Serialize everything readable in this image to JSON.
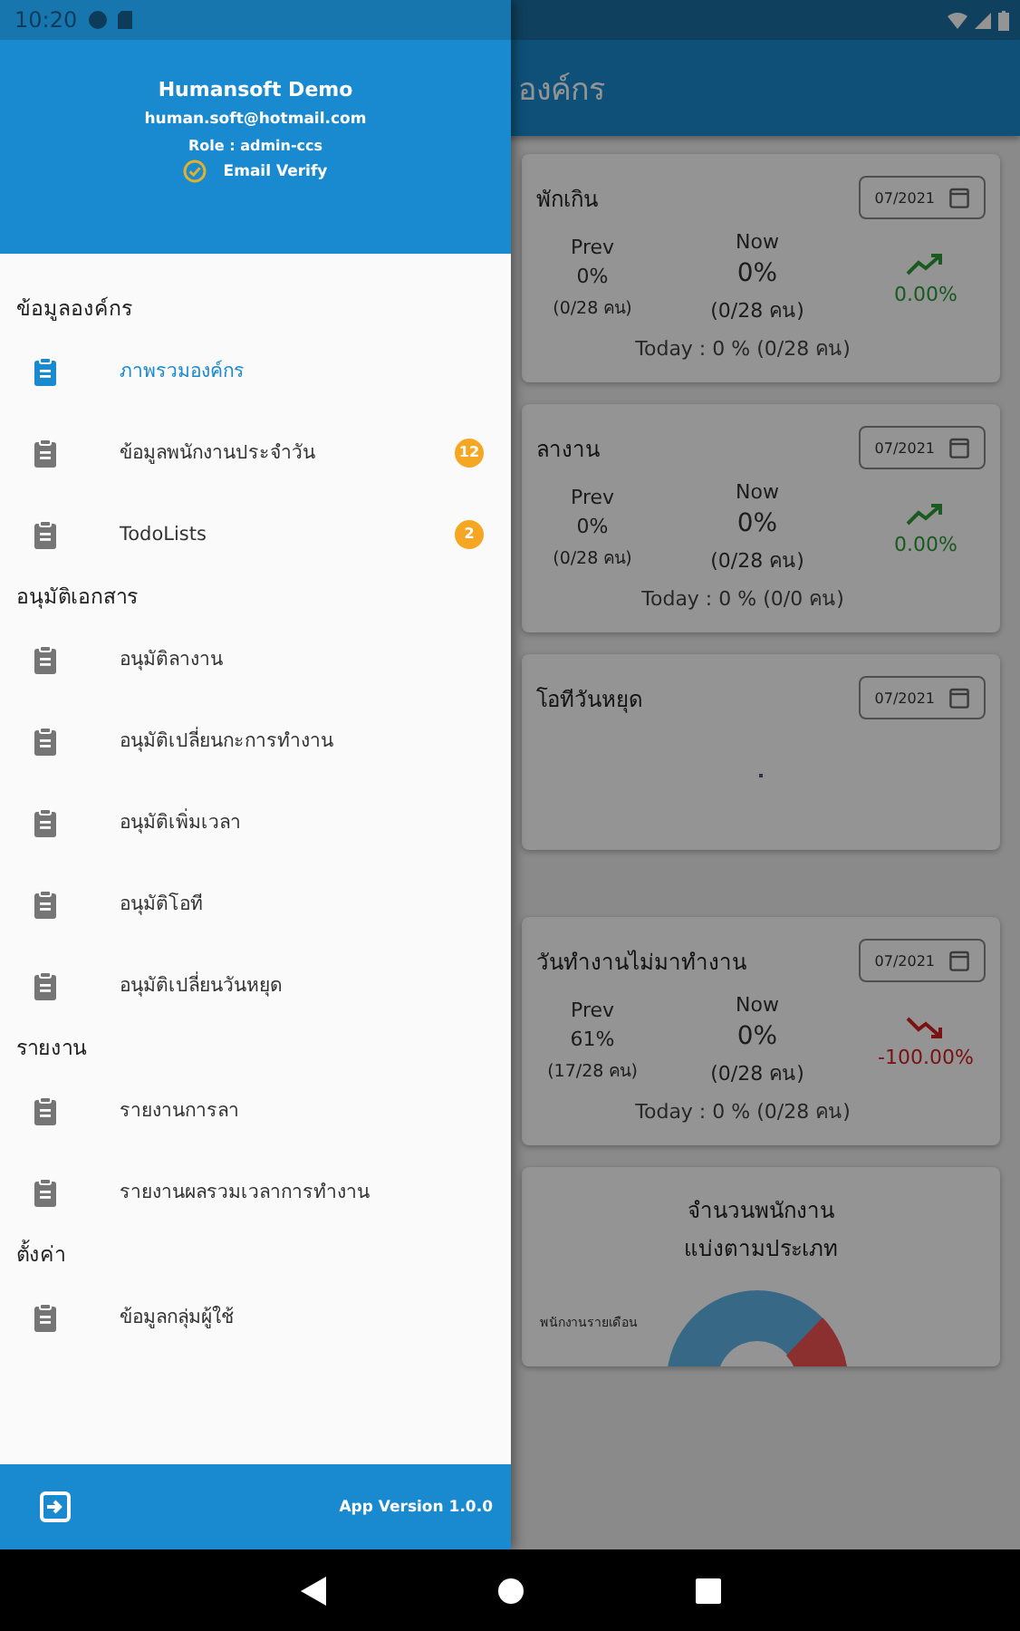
{
  "status_bar": {
    "time": "10:20"
  },
  "app_bar": {
    "title": "องค์กร"
  },
  "cards": [
    {
      "kind": "stats",
      "title": "พักเกิน",
      "date": "07/2021",
      "prev_label": "Prev",
      "prev_value": "0%",
      "prev_count": "(0/28 คน)",
      "now_label": "Now",
      "now_value": "0%",
      "now_count": "(0/28 คน)",
      "today": "Today : 0 % (0/28 คน)",
      "trend": {
        "kind": "up",
        "change": "0.00%"
      }
    },
    {
      "kind": "stats",
      "title": "ลางาน",
      "date": "07/2021",
      "prev_label": "Prev",
      "prev_value": "0%",
      "prev_count": "(0/28 คน)",
      "now_label": "Now",
      "now_value": "0%",
      "now_count": "(0/28 คน)",
      "today": "Today : 0 % (0/0 คน)",
      "trend": {
        "kind": "up",
        "change": "0.00%"
      }
    },
    {
      "kind": "empty",
      "title": "โอทีวันหยุด",
      "date": "07/2021"
    },
    {
      "kind": "stats",
      "title": "วันทำงานไม่มาทำงาน",
      "date": "07/2021",
      "prev_label": "Prev",
      "prev_value": "61%",
      "prev_count": "(17/28 คน)",
      "now_label": "Now",
      "now_value": "0%",
      "now_count": "(0/28 คน)",
      "today": "Today : 0 % (0/28 คน)",
      "trend": {
        "kind": "down",
        "change": "-100.00%"
      }
    },
    {
      "kind": "donut",
      "title_lines": [
        "จำนวนพนักงาน",
        "แบ่งตามประเภท"
      ],
      "legend": "พนักงานรายเดือน"
    }
  ],
  "drawer": {
    "name": "Humansoft Demo",
    "email": "human.soft@hotmail.com",
    "role": "Role : admin-ccs",
    "verify": "Email Verify",
    "sections": [
      {
        "title": "ข้อมูลองค์กร",
        "items": [
          {
            "label": "ภาพรวมองค์กร",
            "selected": true
          },
          {
            "label": "ข้อมูลพนักงานประจำวัน",
            "selected": false,
            "badge": "12"
          },
          {
            "label": "TodoLists",
            "selected": false,
            "badge": "2"
          }
        ]
      },
      {
        "title": "อนุมัติเอกสาร",
        "items": [
          {
            "label": "อนุมัติลางาน",
            "selected": false
          },
          {
            "label": "อนุมัติเปลี่ยนกะการทำงาน",
            "selected": false
          },
          {
            "label": "อนุมัติเพิ่มเวลา",
            "selected": false
          },
          {
            "label": "อนุมัติโอที",
            "selected": false
          },
          {
            "label": "อนุมัติเปลี่ยนวันหยุด",
            "selected": false
          }
        ]
      },
      {
        "title": "รายงาน",
        "items": [
          {
            "label": "รายงานการลา",
            "selected": false
          },
          {
            "label": "รายงานผลรวมเวลาการทำงาน",
            "selected": false
          }
        ]
      },
      {
        "title": "ตั้งค่า",
        "items": [
          {
            "label": "ข้อมูลกลุ่มผู้ใช้",
            "selected": false
          }
        ]
      }
    ],
    "version": "App Version 1.0.0"
  }
}
